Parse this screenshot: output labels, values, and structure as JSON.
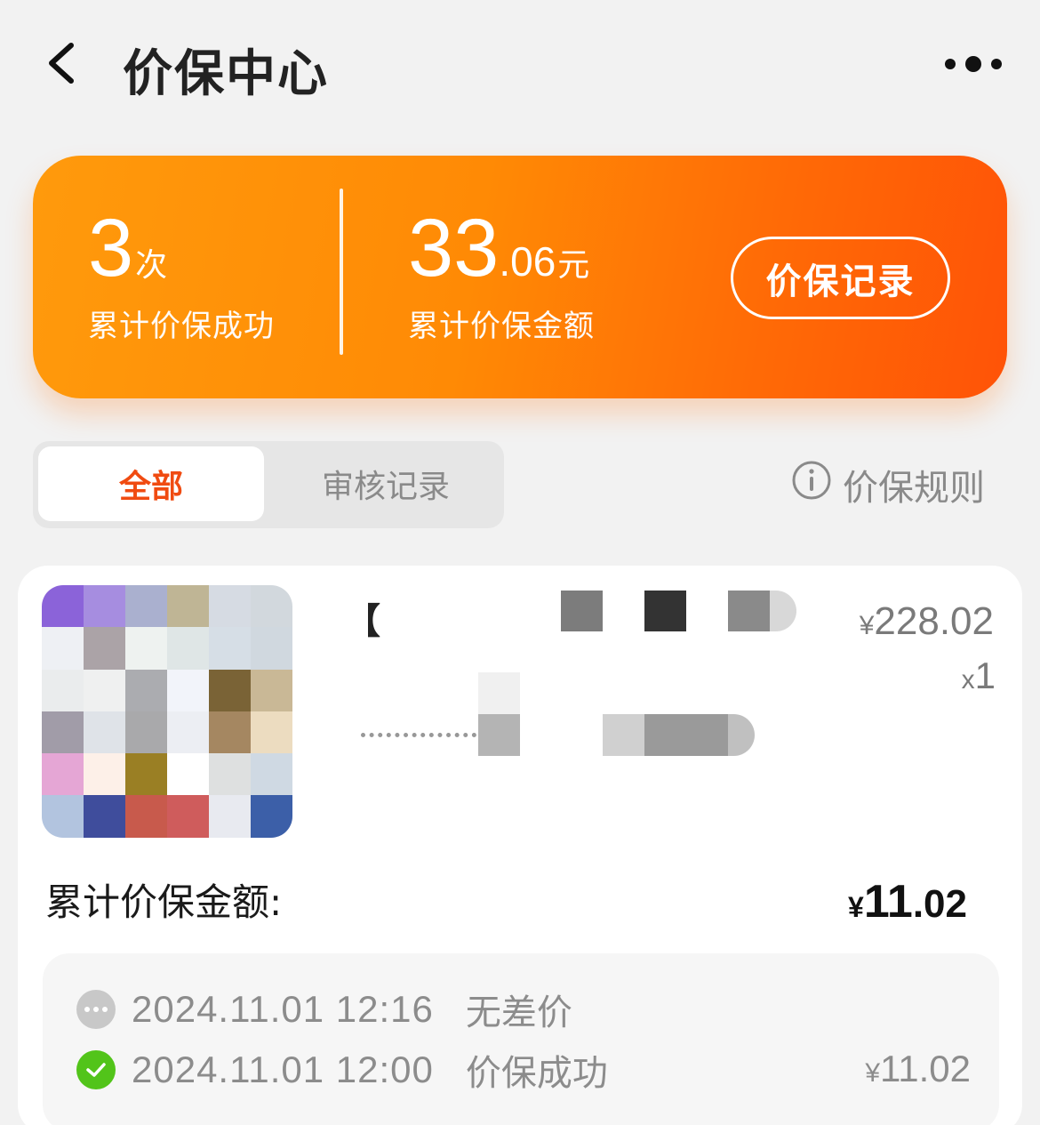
{
  "header": {
    "title": "价保中心"
  },
  "summary": {
    "count": "3",
    "count_unit": "次",
    "count_label": "累计价保成功",
    "amount_int": "33",
    "amount_dec": ".06",
    "amount_unit": "元",
    "amount_label": "累计价保金额",
    "record_button": "价保记录"
  },
  "tabs": {
    "all": "全部",
    "review": "审核记录",
    "active": "全部"
  },
  "rules_label": "价保规则",
  "product": {
    "title_visible": "【",
    "price_symbol": "¥",
    "price": "228.02",
    "qty_prefix": "x",
    "qty": "1",
    "total_label": "累计价保金额:",
    "total_symbol": "¥",
    "total_int": "11",
    "total_dec": ".02",
    "logs": [
      {
        "time": "2024.11.01 12:16",
        "status": "无差价",
        "amount": "",
        "icon": "pending-icon"
      },
      {
        "time": "2024.11.01 12:00",
        "status": "价保成功",
        "amount_symbol": "¥",
        "amount": "11.02",
        "icon": "success-check-icon"
      }
    ]
  },
  "colors": {
    "accent": "#f04b11",
    "card_gradient_start": "#ff9a0c",
    "card_gradient_end": "#ff5307",
    "success": "#52c41a",
    "muted": "#8c8c8c"
  }
}
